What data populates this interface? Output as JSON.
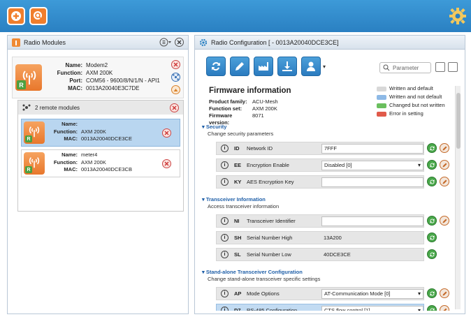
{
  "left_panel": {
    "title": "Radio Modules",
    "local_module": {
      "name_label": "Name:",
      "name": "Modem2",
      "function_label": "Function:",
      "function": "AXM 200K",
      "port_label": "Port:",
      "port": "COM56 - 9600/8/N/1/N - API1",
      "mac_label": "MAC:",
      "mac": "0013A20040E3C7DE"
    },
    "remote": {
      "title": "2 remote modules",
      "items": [
        {
          "name_label": "Name:",
          "name": "",
          "function_label": "Function:",
          "function": "AXM 200K",
          "mac_label": "MAC:",
          "mac": "0013A20040DCE3CE"
        },
        {
          "name_label": "Name:",
          "name": "meter4",
          "function_label": "Function:",
          "function": "AXM 200K",
          "mac_label": "MAC:",
          "mac": "0013A20040DCE3CB"
        }
      ]
    }
  },
  "right_panel": {
    "title": "Radio Configuration [ - 0013A20040DCE3CE]",
    "search_placeholder": "Parameter",
    "firmware": {
      "title": "Firmware information",
      "family_label": "Product family:",
      "family": "ACU-Mesh",
      "function_label": "Function set:",
      "function": "AXM 200K",
      "version_label": "Firmware version:",
      "version": "8071"
    },
    "legend": [
      {
        "label": "Written and default",
        "color": "#d8d8d8"
      },
      {
        "label": "Written and not default",
        "color": "#8db9e6"
      },
      {
        "label": "Changed but not written",
        "color": "#6abf5e"
      },
      {
        "label": "Error in setting",
        "color": "#e05a4a"
      }
    ],
    "sections": [
      {
        "title": "Security",
        "subtitle": "Change security parameters",
        "params": [
          {
            "code": "ID",
            "label": "Network ID",
            "value": "7FFF",
            "kind": "text"
          },
          {
            "code": "EE",
            "label": "Encryption Enable",
            "value": "Disabled [0]",
            "kind": "select"
          },
          {
            "code": "KY",
            "label": "AES Encryption Key",
            "value": "",
            "kind": "text"
          }
        ]
      },
      {
        "title": "Transceiver Information",
        "subtitle": "Access transceiver information",
        "params": [
          {
            "code": "NI",
            "label": "Transceiver Identifier",
            "value": "",
            "kind": "text"
          },
          {
            "code": "SH",
            "label": "Serial Number High",
            "value": "13A200",
            "kind": "readonly"
          },
          {
            "code": "SL",
            "label": "Serial Number Low",
            "value": "40DCE3CE",
            "kind": "readonly"
          }
        ]
      },
      {
        "title": "Stand-alone Transceiver Configuration",
        "subtitle": "Change stand-alone transceiver specific settings",
        "params": [
          {
            "code": "AP",
            "label": "Mode Options",
            "value": "AT-Communication Mode [0]",
            "kind": "select"
          },
          {
            "code": "D7",
            "label": "RS-485 Configuration",
            "value": "CTS flow control [1]",
            "kind": "select"
          }
        ]
      }
    ]
  }
}
